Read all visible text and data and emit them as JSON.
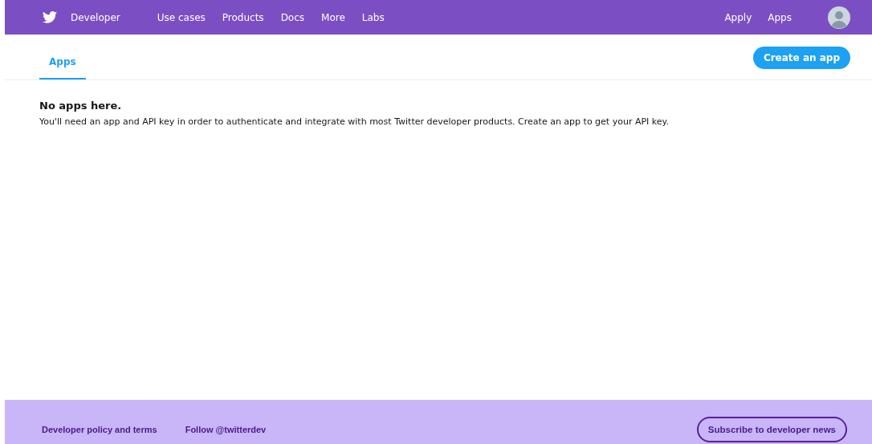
{
  "header": {
    "brand": "Developer",
    "nav": [
      "Use cases",
      "Products",
      "Docs",
      "More",
      "Labs"
    ],
    "right_links": [
      "Apply",
      "Apps"
    ]
  },
  "tabs": [
    {
      "label": "Apps",
      "selected": true
    }
  ],
  "create_button": "Create an app",
  "empty_state": {
    "title": "No apps here.",
    "message": "You'll need an app and API key in order to authenticate and integrate with most Twitter developer products. Create an app to get your API key."
  },
  "footer": {
    "links": [
      "Developer policy and terms",
      "Follow @twitterdev"
    ],
    "subscribe_button": "Subscribe to developer news"
  }
}
